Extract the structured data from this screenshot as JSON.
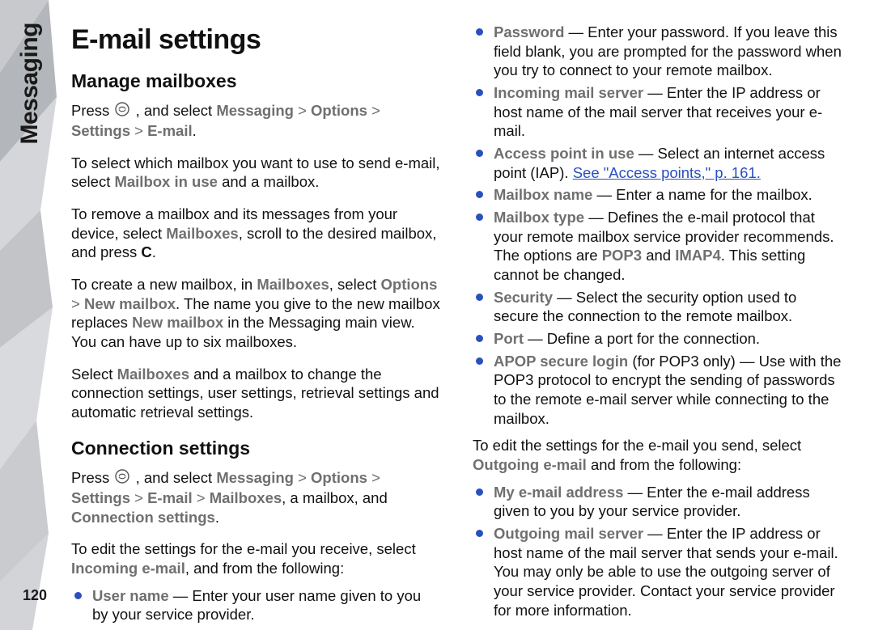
{
  "sidebar": {
    "label": "Messaging"
  },
  "page_number": "120",
  "left": {
    "h1": "E-mail settings",
    "h2a": "Manage mailboxes",
    "nav1_pre": "Press ",
    "nav1_post": " , and select ",
    "nav1_path": [
      "Messaging",
      "Options",
      "Settings",
      "E-mail"
    ],
    "p1_a": "To select which mailbox you want to use to send e-mail, select ",
    "p1_b": "Mailbox in use",
    "p1_c": " and a mailbox.",
    "p2_a": "To remove a mailbox and its messages from your device, select ",
    "p2_b": "Mailboxes",
    "p2_c": ", scroll to the desired mailbox, and press ",
    "p2_d": "C",
    "p2_e": ".",
    "p3_a": "To create a new mailbox, in ",
    "p3_b": "Mailboxes",
    "p3_c": ", select ",
    "p3_d": "Options",
    "p3_e": "New mailbox",
    "p3_f": ". The name you give to the new mailbox replaces ",
    "p3_g": "New mailbox",
    "p3_h": " in the Messaging main view. You can have up to six mailboxes.",
    "p4_a": "Select ",
    "p4_b": "Mailboxes",
    "p4_c": " and a mailbox to change the connection settings, user settings, retrieval settings and automatic retrieval settings.",
    "h2b": "Connection settings",
    "nav2_pre": "Press ",
    "nav2_post": " , and select ",
    "nav2_path": [
      "Messaging",
      "Options",
      "Settings",
      "E-mail",
      "Mailboxes"
    ],
    "nav2_tail": ", a mailbox, and ",
    "nav2_last": "Connection settings",
    "p5_a": "To edit the settings for the e-mail you receive, select ",
    "p5_b": "Incoming e-mail",
    "p5_c": ", and from the following:",
    "li_user_t": "User name",
    "li_user_d": " — Enter your user name given to you by your service provider."
  },
  "right": {
    "li_pass_t": "Password",
    "li_pass_d": " — Enter your password. If you leave this field blank, you are prompted for the password when you try to connect to your remote mailbox.",
    "li_in_t": "Incoming mail server",
    "li_in_d": " — Enter the IP address or host name of the mail server that receives your e-mail.",
    "li_ap_t": "Access point in use",
    "li_ap_d1": " — Select an internet access point (IAP). ",
    "li_ap_link": "See \"Access points,\" p. 161.",
    "li_mn_t": "Mailbox name",
    "li_mn_d": " — Enter a name for the mailbox.",
    "li_mt_t": "Mailbox type",
    "li_mt_d1": " — Defines the e-mail protocol that your remote mailbox service provider recommends. The options are ",
    "li_mt_b1": "POP3",
    "li_mt_mid": " and ",
    "li_mt_b2": "IMAP4",
    "li_mt_d2": ". This setting cannot be changed.",
    "li_sec_t": "Security",
    "li_sec_d": " — Select the security option used to secure the connection to the remote mailbox.",
    "li_port_t": "Port",
    "li_port_d": " — Define a port for the connection.",
    "li_apop_t": "APOP secure login",
    "li_apop_d": " (for POP3 only) — Use with the POP3 protocol to encrypt the sending of passwords to the remote e-mail server while connecting to the mailbox.",
    "p_out_a": "To edit the settings for the e-mail you send, select ",
    "p_out_b": "Outgoing e-mail",
    "p_out_c": " and from the following:",
    "li_my_t": "My e-mail address",
    "li_my_d": " — Enter the e-mail address given to you by your service provider.",
    "li_og_t": "Outgoing mail server",
    "li_og_d": " — Enter the IP address or host name of the mail server that sends your e-mail. You may only be able to use the outgoing server of your service provider. Contact your service provider for more information."
  }
}
